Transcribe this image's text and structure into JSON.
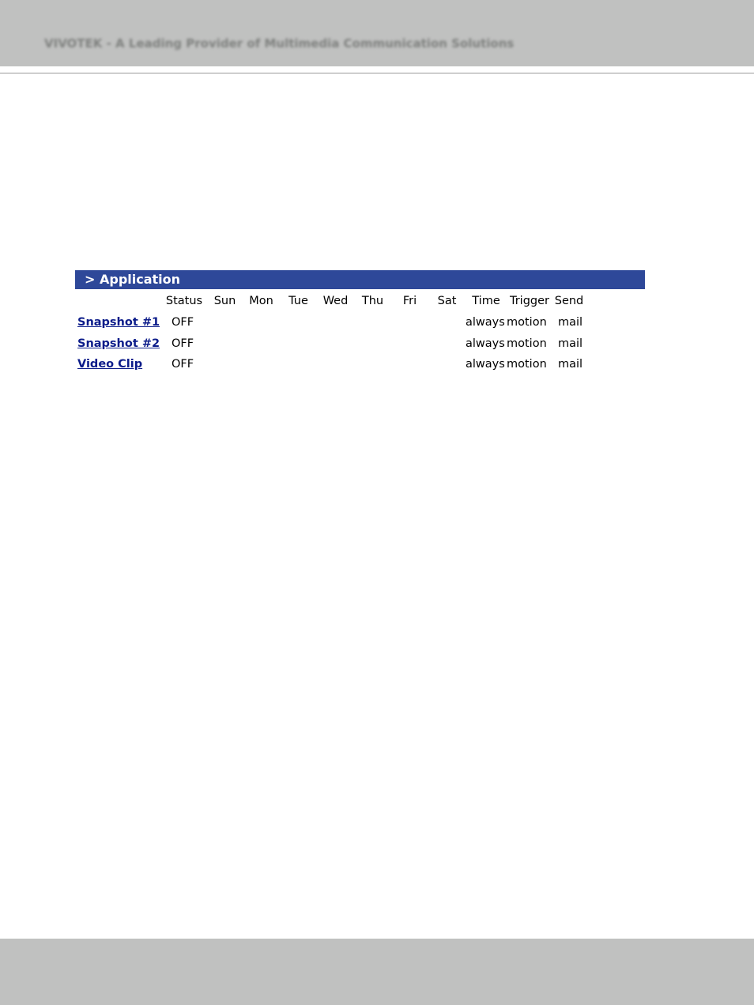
{
  "page": {
    "header_text": "VIVOTEK - A Leading Provider of Multimedia Communication Solutions"
  },
  "application": {
    "title": "> Application",
    "columns": {
      "status": "Status",
      "sun": "Sun",
      "mon": "Mon",
      "tue": "Tue",
      "wed": "Wed",
      "thu": "Thu",
      "fri": "Fri",
      "sat": "Sat",
      "time": "Time",
      "trigger": "Trigger",
      "send": "Send"
    },
    "rows": [
      {
        "name": "Snapshot #1",
        "status": "OFF",
        "sun": "",
        "mon": "",
        "tue": "",
        "wed": "",
        "thu": "",
        "fri": "",
        "sat": "",
        "time": "always",
        "trigger": "motion",
        "send": "mail"
      },
      {
        "name": "Snapshot #2",
        "status": "OFF",
        "sun": "",
        "mon": "",
        "tue": "",
        "wed": "",
        "thu": "",
        "fri": "",
        "sat": "",
        "time": "always",
        "trigger": "motion",
        "send": "mail"
      },
      {
        "name": "Video Clip",
        "status": "OFF",
        "sun": "",
        "mon": "",
        "tue": "",
        "wed": "",
        "thu": "",
        "fri": "",
        "sat": "",
        "time": "always",
        "trigger": "motion",
        "send": "mail"
      }
    ]
  },
  "colors": {
    "band": "#c0c1c0",
    "section_header": "#2e4899",
    "link": "#0c1c8a"
  }
}
